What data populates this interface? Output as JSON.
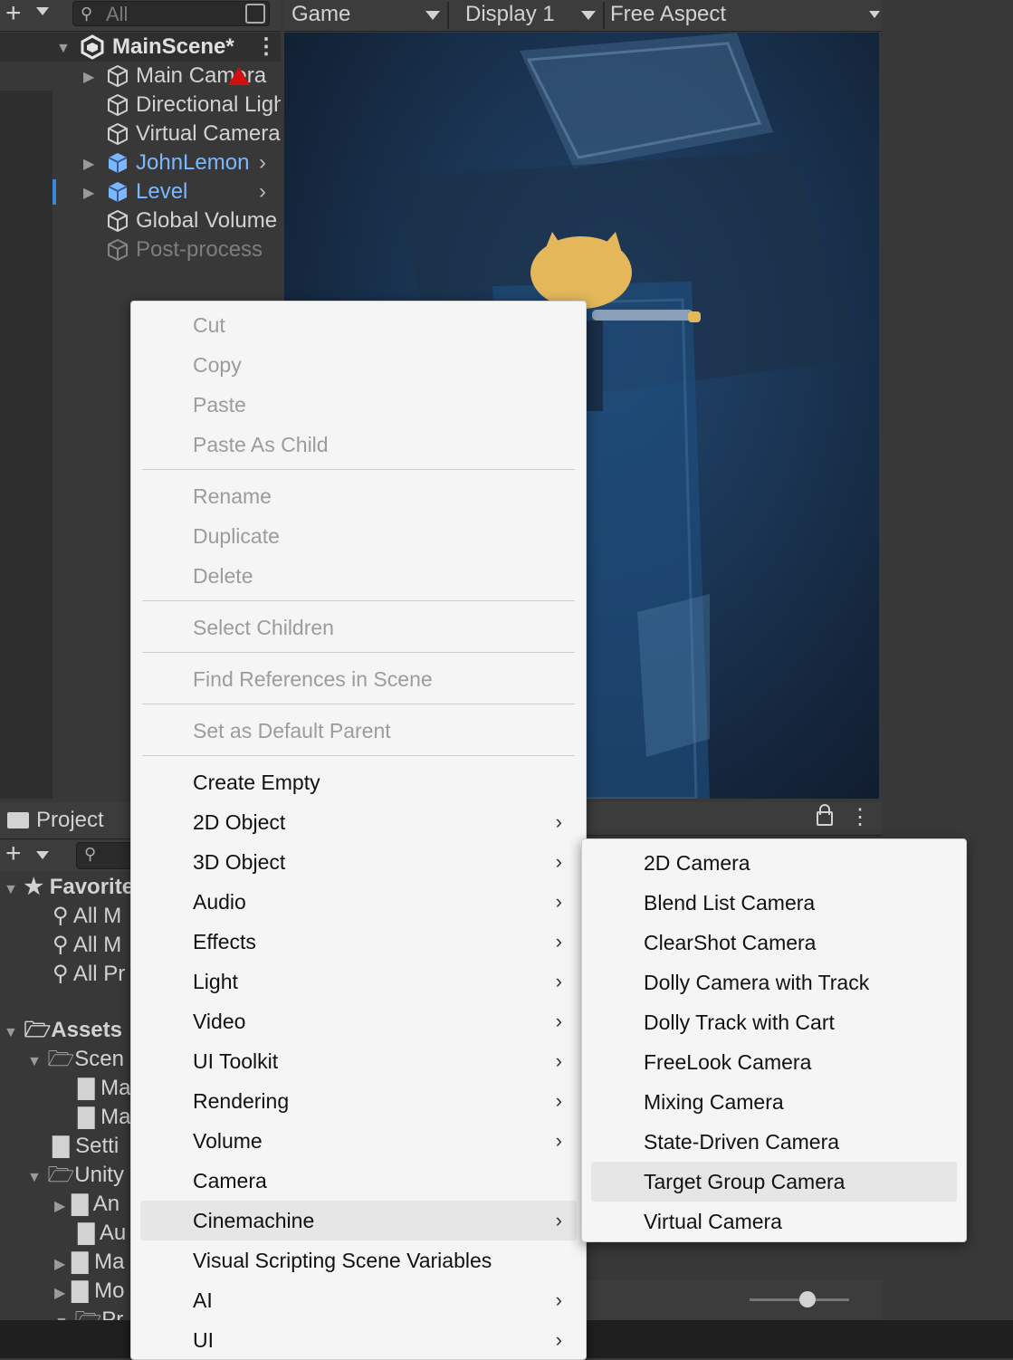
{
  "hierarchy": {
    "search_placeholder": "All",
    "scene": "MainScene*",
    "items": [
      {
        "label": "Main Camera"
      },
      {
        "label": "Directional Light"
      },
      {
        "label": "Virtual Camera"
      },
      {
        "label": "JohnLemon"
      },
      {
        "label": "Level"
      },
      {
        "label": "Global Volume"
      },
      {
        "label": "Post-process"
      }
    ]
  },
  "game": {
    "tab": "Game",
    "display": "Display 1",
    "aspect": "Free Aspect"
  },
  "project": {
    "tab": "Project",
    "rows": [
      "Favorites",
      "All M",
      "All M",
      "All Pr",
      "Assets",
      "Scen",
      "Ma",
      "Ma",
      "Setti",
      "Unity",
      "An",
      "Au",
      "Ma",
      "Mo",
      "Pr"
    ]
  },
  "context_menu": {
    "group1": [
      "Cut",
      "Copy",
      "Paste",
      "Paste As Child"
    ],
    "group2": [
      "Rename",
      "Duplicate",
      "Delete"
    ],
    "group3": [
      "Select Children"
    ],
    "group4": [
      "Find References in Scene"
    ],
    "group5": [
      "Set as Default Parent"
    ],
    "create": [
      {
        "label": "Create Empty",
        "submenu": false
      },
      {
        "label": "2D Object",
        "submenu": true
      },
      {
        "label": "3D Object",
        "submenu": true
      },
      {
        "label": "Audio",
        "submenu": true
      },
      {
        "label": "Effects",
        "submenu": true
      },
      {
        "label": "Light",
        "submenu": true
      },
      {
        "label": "Video",
        "submenu": true
      },
      {
        "label": "UI Toolkit",
        "submenu": true
      },
      {
        "label": "Rendering",
        "submenu": true
      },
      {
        "label": "Volume",
        "submenu": true
      },
      {
        "label": "Camera",
        "submenu": false
      },
      {
        "label": "Cinemachine",
        "submenu": true
      },
      {
        "label": "Visual Scripting Scene Variables",
        "submenu": false
      },
      {
        "label": "AI",
        "submenu": true
      },
      {
        "label": "UI",
        "submenu": true
      }
    ]
  },
  "cinemachine_submenu": [
    "2D Camera",
    "Blend List Camera",
    "ClearShot Camera",
    "Dolly Camera with Track",
    "Dolly Track with Cart",
    "FreeLook Camera",
    "Mixing Camera",
    "State-Driven Camera",
    "Target Group Camera",
    "Virtual Camera"
  ],
  "colors": {
    "prefab_blue": "#7cb8ff",
    "menu_bg": "#f5f5f5",
    "menu_highlight": "#e6e6e6",
    "disabled_text": "#9c9c9c"
  }
}
